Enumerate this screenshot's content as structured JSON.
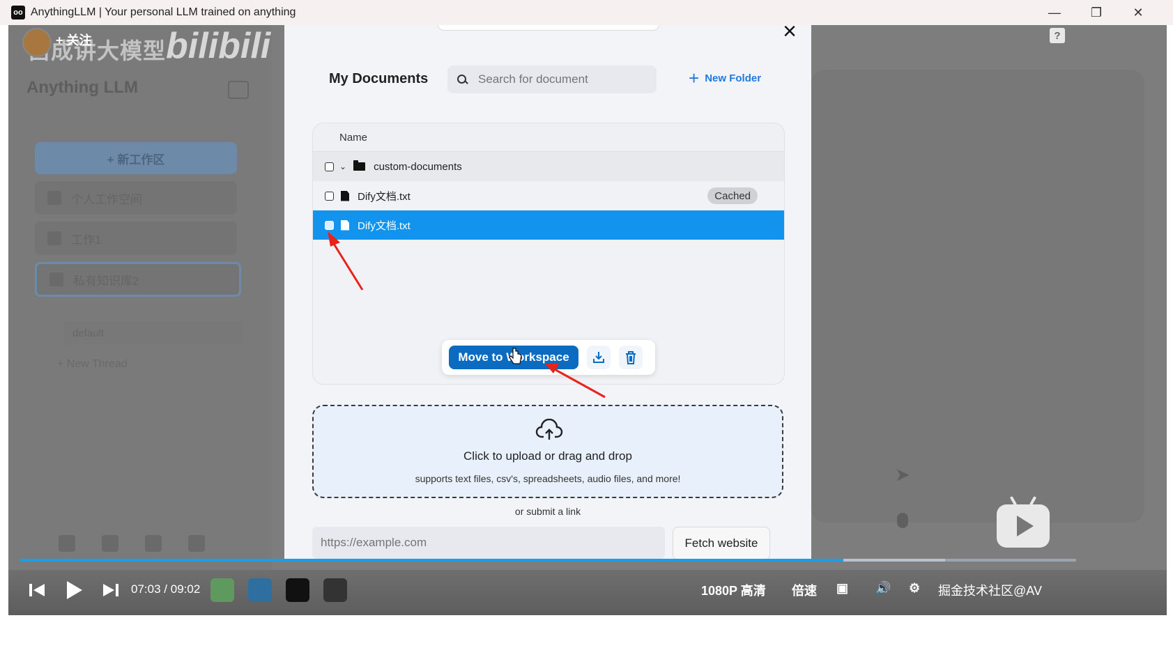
{
  "window": {
    "icon_label": "oo",
    "title": "AnythingLLM | Your personal LLM trained on anything"
  },
  "bilibili": {
    "follow": "+ 关注",
    "channel": "吕成讲大模型",
    "logo": "bilibili"
  },
  "sidebar": {
    "logo": "Anything LLM",
    "new_workspace": "+ 新工作区",
    "workspaces": [
      "个人工作空间",
      "工作1",
      "私有知识库2"
    ],
    "thread_default": "default",
    "new_thread": "+   New Thread"
  },
  "modal": {
    "title": "My Documents",
    "search_placeholder": "Search for document",
    "new_folder": "New Folder",
    "table_header": "Name",
    "rows": [
      {
        "name": "custom-documents",
        "type": "folder"
      },
      {
        "name": "Dify文档.txt",
        "type": "file",
        "badge": "Cached"
      },
      {
        "name": "Dify文档.txt",
        "type": "file",
        "selected": true
      }
    ],
    "move_button": "Move to Workspace",
    "upload_title": "Click to upload or drag and drop",
    "upload_subtitle": "supports text files, csv's, spreadsheets, audio files, and more!",
    "or_submit": "or submit a link",
    "link_placeholder": "https://example.com",
    "fetch_button": "Fetch website"
  },
  "player": {
    "current_time": "07:03",
    "separator": "/",
    "total_time": "09:02",
    "quality": "1080P 高清",
    "speed": "倍速",
    "watermark": "掘金技术社区@AV",
    "progress_fraction": 0.78
  },
  "colors": {
    "accent": "#1193ee",
    "primary_button": "#0b6bc0",
    "link": "#1f7ae0",
    "annotation_arrow": "#e8231b"
  }
}
